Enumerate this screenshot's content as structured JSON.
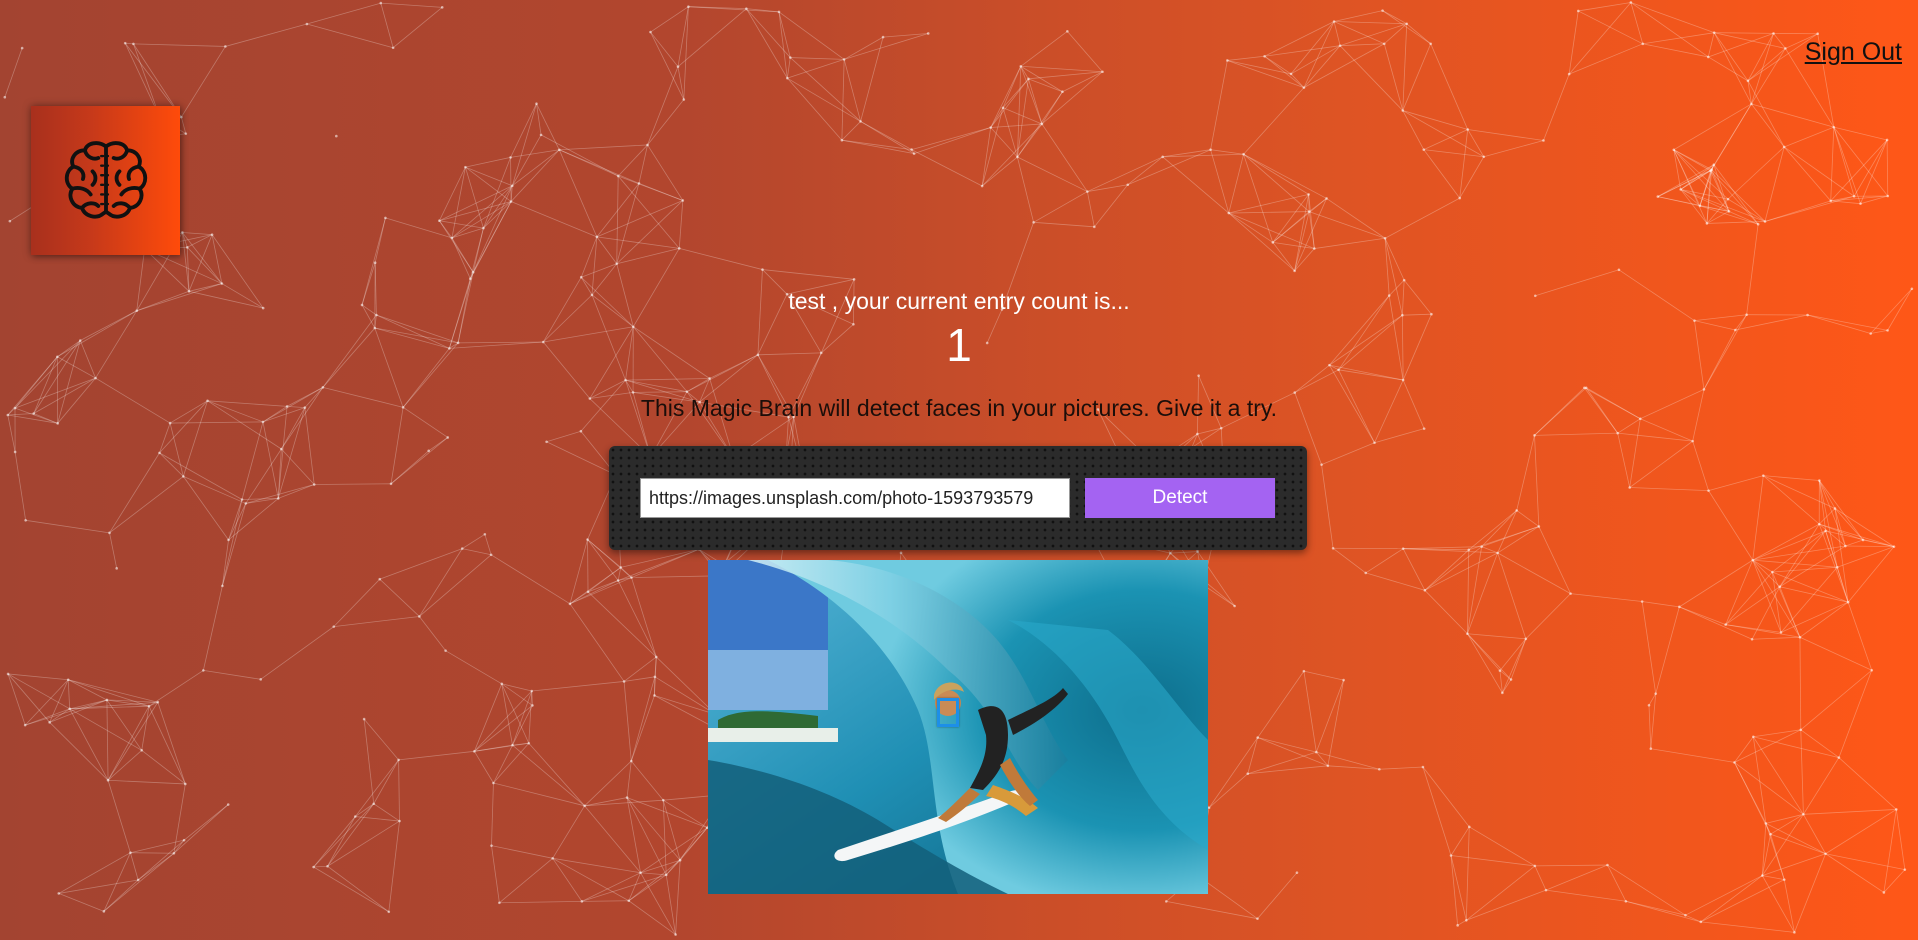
{
  "nav": {
    "signout_label": "Sign Out"
  },
  "logo": {
    "icon": "brain-icon"
  },
  "rank": {
    "message": "test , your current entry count is...",
    "count": "1"
  },
  "intro": {
    "text": "This Magic Brain will detect faces in your pictures. Give it a try."
  },
  "form": {
    "url_value": "https://images.unsplash.com/photo-1593793579",
    "detect_label": "Detect"
  },
  "detection": {
    "image_subject": "surfer-in-wave",
    "faces_found": 1,
    "box_color": "#1d8fe8"
  },
  "colors": {
    "background_start": "#a34431",
    "background_end": "#ff5717",
    "button": "#a463f2",
    "panel": "#2b2b2b"
  }
}
